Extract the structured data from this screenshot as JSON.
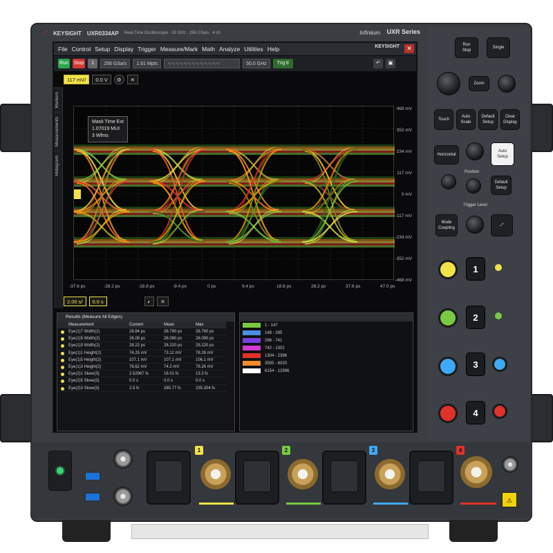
{
  "colors": {
    "ch1": "#f1e24a",
    "ch2": "#7ac943",
    "ch3": "#3fa9f5",
    "ch4": "#e0322b",
    "run": "#2ea44f",
    "stop": "#d13a32"
  },
  "brand": {
    "name": "KEYSIGHT",
    "model": "UXR0334AP",
    "model_desc": "Real-Time Oscilloscope · 33 GHz · 256 GSa/s · 4 ch",
    "software": "Infiniium",
    "series": "UXR Series"
  },
  "menu": [
    "File",
    "Control",
    "Setup",
    "Display",
    "Trigger",
    "Measure/Mark",
    "Math",
    "Analyze",
    "Utilities",
    "Help"
  ],
  "toolbar": {
    "run": "Run",
    "stop": "Stop",
    "single": "1",
    "sample_rate": "256 GSa/s",
    "memory": "1.61 Mpts",
    "ref_level": "50.0 GHz",
    "trigger": "Trig'd"
  },
  "channel_top": {
    "scale": "117 mV/",
    "offset": "0.0 V"
  },
  "channel_bottom": {
    "scale": "2.00 s/",
    "delay": "0.0 s"
  },
  "marker": {
    "line1": "Mask Time Ext",
    "line2": "1.07019 MUI",
    "line3": "3 Wfms"
  },
  "side_tabs": [
    "Markers",
    "Measurements",
    "Histogram"
  ],
  "y_axis": [
    "468 mV",
    "352 mV",
    "234 mV",
    "117 mV",
    "0 mV",
    "-117 mV",
    "-234 mV",
    "-352 mV",
    "-468 mV"
  ],
  "x_axis": [
    "-37.6 ps",
    "-28.2 ps",
    "-18.8 ps",
    "-9.4 ps",
    "0 ps",
    "9.4 ps",
    "18.8 ps",
    "28.2 ps",
    "37.6 ps",
    "47.0 ps"
  ],
  "results": {
    "title": "Results (Measure All Edges)",
    "headers": [
      "",
      "Measurement",
      "Current",
      "Mean",
      "Max"
    ],
    "rows": [
      [
        "",
        "Eye(1)7 Width(2)",
        "28.84 ps",
        "28.790 ps",
        "28.790 ps"
      ],
      [
        "",
        "Eye(1)5 Width(2)",
        "26.08 ps",
        "26.090 ps",
        "26.090 ps"
      ],
      [
        "",
        "Eye(1)3 Width(2)",
        "28.22 ps",
        "28.220 ps",
        "28.220 ps"
      ],
      [
        "",
        "Eye(1)1 Height(2)",
        "74.25 mV",
        "73.12 mV",
        "78.26 mV"
      ],
      [
        "",
        "Eye(1)5 Height(2)",
        "107.1 mV",
        "107.1 mV",
        "106.1 mV"
      ],
      [
        "",
        "Eye(1)3 Height(2)",
        "78.62 mV",
        "74.2 mV",
        "78.26 mV"
      ],
      [
        "",
        "Eye(2)1 Skew(3)",
        "2.52967 fs",
        "16.01 fs",
        "13.3 fs"
      ],
      [
        "",
        "Eye(2)5 Skew(3)",
        "0.0 s",
        "0.0 s",
        "0.0 s"
      ],
      [
        "",
        "Eye(2)3 Skew(3)",
        "2.5 fs",
        "285.77 fs",
        "235.304 fs"
      ]
    ]
  },
  "histogram": [
    {
      "color": "#7ac943",
      "label": "1 - 147"
    },
    {
      "color": "#4a8fe0",
      "label": "148 - 295"
    },
    {
      "color": "#7a3fe0",
      "label": "296 - 741"
    },
    {
      "color": "#d23bd2",
      "label": "742 - 1302"
    },
    {
      "color": "#e0322b",
      "label": "1304 - 2396"
    },
    {
      "color": "#f28c28",
      "label": "3505 - 6020"
    },
    {
      "color": "#ffffff",
      "label": "6154 - 12996"
    }
  ],
  "panel": {
    "run_stop": "Run\nStop",
    "single": "Single",
    "zoom": "Zoom",
    "touch": "Touch",
    "auto_scale": "Auto\nScale",
    "default_setup": "Default\nSetup",
    "clear_display": "Clear\nDisplay",
    "horizontal": "Horizontal",
    "position": "Position",
    "trigger_level": "Trigger Level",
    "mode": "Mode\nCoupling",
    "auto_setup": "Auto\nSetup",
    "default": "Default\nSetup",
    "ch_numbers": [
      "1",
      "2",
      "3",
      "4"
    ]
  },
  "front": {
    "input_tags": [
      "1",
      "2",
      "3",
      "4"
    ]
  }
}
